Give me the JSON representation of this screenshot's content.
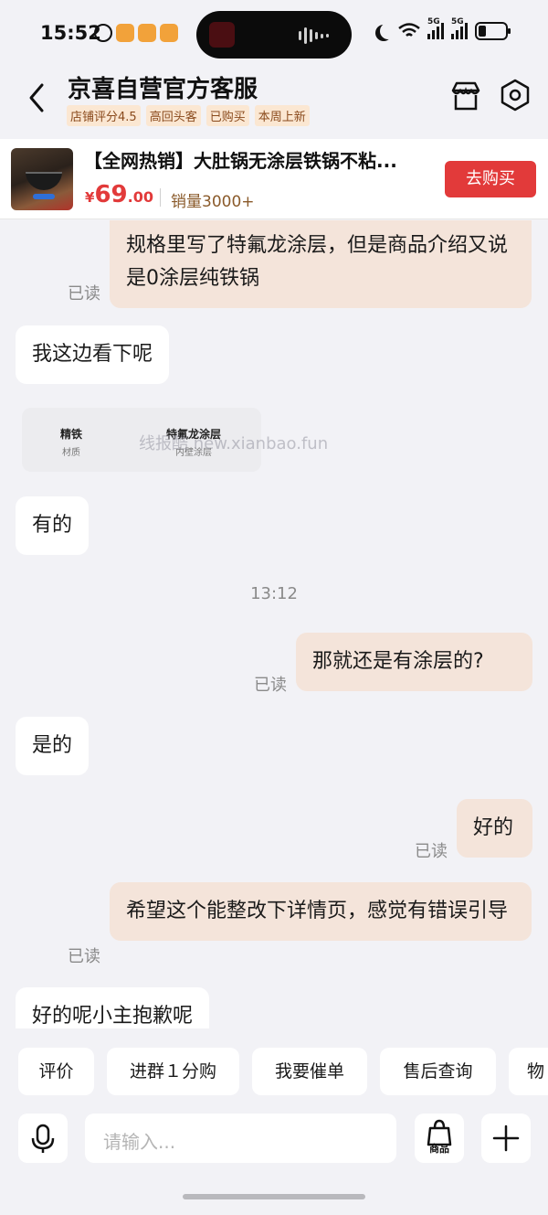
{
  "status_bar": {
    "time": "15:52",
    "signal_1": "5G",
    "signal_2": "5G"
  },
  "header": {
    "shop_name": "京喜自营官方客服",
    "tags": [
      "店铺评分4.5",
      "高回头客",
      "已购买",
      "本周上新"
    ]
  },
  "product": {
    "title": "【全网热销】大肚锅无涂层铁锅不粘...",
    "price_currency": "¥",
    "price_integer": "69",
    "price_decimal": ".00",
    "sales": "销量3000+",
    "buy_label": "去购买"
  },
  "chat": {
    "messages": [
      {
        "text": "规格里写了特氟龙涂层，但是商品介绍又说是0涂层纯铁锅",
        "read": "已读"
      },
      {
        "text": "我这边看下呢"
      },
      {
        "text": "有的"
      },
      {
        "timestamp": "13:12"
      },
      {
        "text": "那就还是有涂层的?",
        "read": "已读"
      },
      {
        "text": "是的"
      },
      {
        "text": "好的",
        "read": "已读"
      },
      {
        "text": "希望这个能整改下详情页，感觉有错误引导",
        "read": "已读"
      },
      {
        "text": "好的呢小主抱歉呢"
      }
    ],
    "spec_card": [
      {
        "value": "精铁",
        "key": "材质"
      },
      {
        "value": "特氟龙涂层",
        "key": "内壁涂层"
      }
    ],
    "watermark": "线报酷 new.xianbao.fun"
  },
  "quick_actions": [
    "评价",
    "进群１分购",
    "我要催单",
    "售后查询",
    "物"
  ],
  "input": {
    "placeholder": "请输入...",
    "goods_label": "商品"
  },
  "colors": {
    "accent_red": "#e23a3a",
    "my_bubble": "#f4e4da",
    "background": "#f2f2f6"
  }
}
